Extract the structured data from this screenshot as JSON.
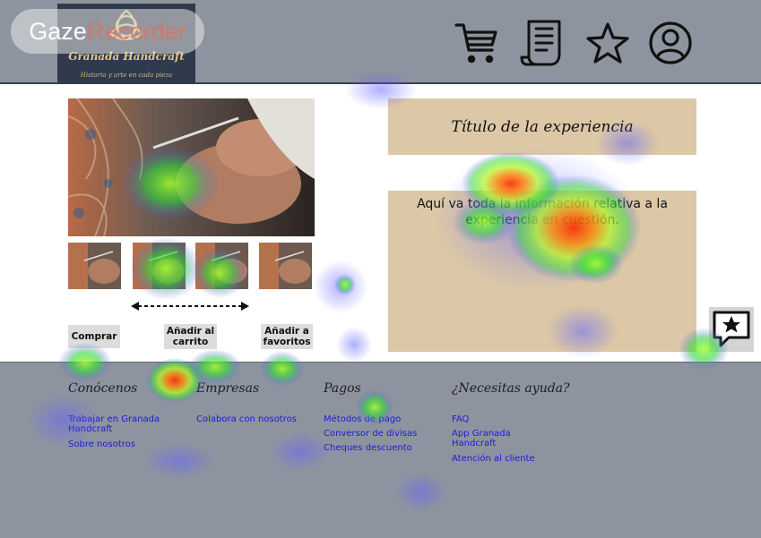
{
  "watermark": {
    "part1": "Gaze",
    "part2": "Recorder"
  },
  "header": {
    "logo_title": "Granada Handcraft",
    "logo_tagline": "Historia y arte en cada pieza",
    "icons": [
      "cart-icon",
      "receipt-icon",
      "star-icon",
      "user-icon"
    ]
  },
  "product": {
    "buttons": {
      "buy": "Comprar",
      "add_cart": "Añadir al carrito",
      "add_fav": "Añadir a favoritos"
    }
  },
  "experience": {
    "title": "Título de la experiencia",
    "info": "Aquí va toda la información relativa a la experiencia en cuestión."
  },
  "footer": {
    "columns": [
      {
        "heading": "Conócenos",
        "links": [
          "Trabajar en Granada Handcraft",
          "Sobre nosotros"
        ]
      },
      {
        "heading": "Empresas",
        "links": [
          "Colabora con nosotros"
        ]
      },
      {
        "heading": "Pagos",
        "links": [
          "Métodos de pago",
          "Conversor de divisas",
          "Cheques descuento"
        ]
      },
      {
        "heading": "¿Necesitas ayuda?",
        "links": [
          "FAQ",
          "App Granada Handcraft",
          "Atención al cliente"
        ]
      }
    ]
  },
  "colors": {
    "header_bg": "#8e949f",
    "box_bg": "#dcc8a6",
    "link": "#1a1ad6",
    "logo_bg": "#2f3a4d"
  }
}
